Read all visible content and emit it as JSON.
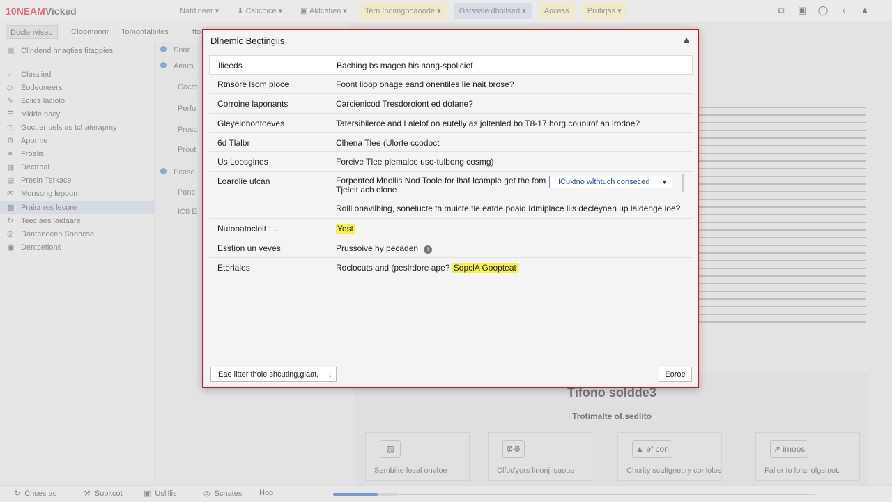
{
  "app": {
    "logo_prefix": "10",
    "logo_brand": "NEAM",
    "logo_rest": "Vicked"
  },
  "topnav": [
    {
      "label": "Natdineer ▾"
    },
    {
      "label": "⬇ Cslicoice ▾"
    },
    {
      "label": "▣ Aldcatien ▾"
    },
    {
      "label": "Tern Inoimgpoaoode ▾"
    },
    {
      "label": "Gatsssle dboltsed ▾"
    },
    {
      "label": "Aocess"
    },
    {
      "label": "Prutiqas ▾"
    }
  ],
  "topicons": [
    "⧉",
    "▣",
    "◯",
    "‹",
    "▲"
  ],
  "subtabs": [
    "Doclenvtseo",
    "CIoomonrir",
    "Tomontalbites",
    "tto"
  ],
  "sidebar": {
    "header": "Clindend hnagties fitagpies",
    "items": [
      "Chnalied",
      "Eodeoneers",
      "Eclics laclolo",
      "Midde nacy",
      "Goct er uels as tchaterapmy",
      "Aporme",
      "Froelis",
      "Dectrbal",
      "Presin Terkace",
      "Monsong lepoum",
      "Praicr res lecore",
      "Teeclaes laidaare",
      "Dantanecen Snohcse",
      "Dentcetions"
    ]
  },
  "col2": [
    "Sonr",
    "Aimro",
    "Cocto",
    "Perfu",
    "Proso",
    "Prout",
    "Ecose",
    "Panc",
    "IC8 E"
  ],
  "lower": {
    "title": "Tifono soldde3",
    "subtitle": "Trotimalte of.sedlito",
    "cards": [
      {
        "icon": "▨",
        "label": "Sembiite losal onvfoe"
      },
      {
        "icon": "⚙⚙",
        "label": "Clfcc'yors linonj lsaous"
      },
      {
        "icon": "▲ ef con",
        "label": "Chcrity scaltgnetiry conlolos"
      },
      {
        "icon": "↗ imoos",
        "label": "Faller to lora lolgsmot."
      }
    ]
  },
  "bottombar": [
    {
      "icon": "↻",
      "label": "Chses ad"
    },
    {
      "icon": "⚒",
      "label": "Sopltcot"
    },
    {
      "icon": "▣",
      "label": "Uslillis"
    },
    {
      "icon": "◎",
      "label": "Scnates"
    },
    {
      "icon": "",
      "label": "Hop"
    }
  ],
  "progress_fraction": 0.7,
  "dialog": {
    "title": "Dlnemic Bectingiis",
    "rows": [
      {
        "label": "Ilieeds",
        "value": "Baching bs magen his nang-spolicief"
      },
      {
        "label": "Rtnsore lsom ploce",
        "value": "Foont lioop onage eand onentiles lie nait brose?"
      },
      {
        "label": "Corroine laponants",
        "value": "Carcienicod Tresdoroiont ed dofane?"
      },
      {
        "label": "Gleyelohontoeves",
        "value": "Tatersibilerce and Lalelof on eutelly as joltenled bo T8-17 horg.counirof an lrodoe?"
      },
      {
        "label": "6d Tlalbr",
        "value": "Clhena Tlee (Ulorte ccodoct"
      },
      {
        "label": "Us Loosgines",
        "value": "Foreive Tlee plemalce uso-tulbong cosmg)"
      },
      {
        "label": "Loardlie utcan",
        "value_line1": "Forpented Mnollis Nod Toole for lhaf Icample get the fom",
        "value_line2": "Tjeleit ach olone",
        "select": "ICuktno wlthtuch conseced",
        "value_line3": "Rolll onavilbing, sonelucte th muicte tle eatde poaid Idmiplace liis decleynen up laidenge loe?"
      },
      {
        "label": "Nutonatoclolt :....",
        "value": "Yest",
        "highlight": true
      },
      {
        "label": "Esstion un veves",
        "value": "Prussoive hy pecaden"
      },
      {
        "label": "Eterlales",
        "value": "Roclocuts and (peslrdore ape?",
        "badge": "SopclA Goopteat"
      }
    ],
    "footer_select": "Eae litter thole shcuting,glaat,",
    "footer_button": "Eoroe"
  }
}
